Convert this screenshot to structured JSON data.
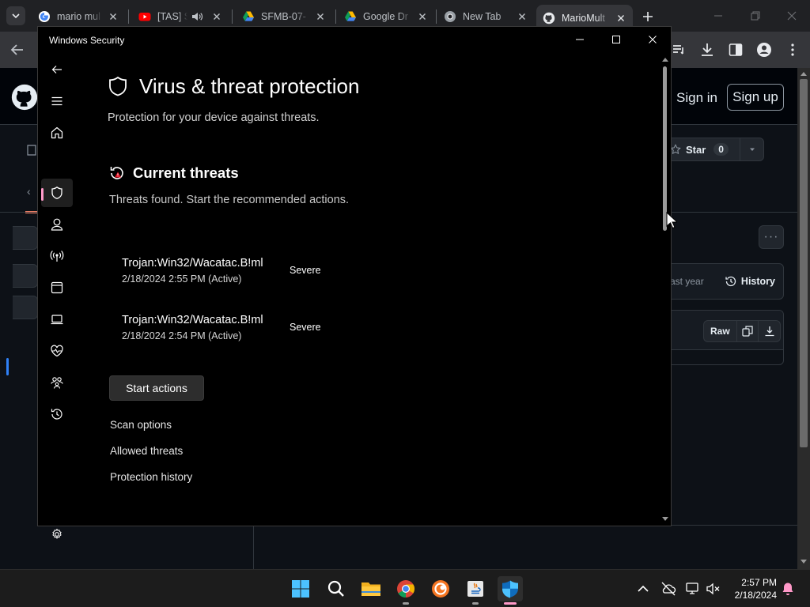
{
  "browser": {
    "tabs": [
      {
        "title": "mario mul",
        "favicon": "google-icon"
      },
      {
        "title": "[TAS] S",
        "favicon": "youtube-icon",
        "audio": true
      },
      {
        "title": "SFMB-07-",
        "favicon": "google-drive-icon"
      },
      {
        "title": "Google Dr",
        "favicon": "google-drive-icon"
      },
      {
        "title": "New Tab",
        "favicon": "chrome-icon"
      },
      {
        "title": "MarioMult",
        "favicon": "github-icon",
        "active": true
      }
    ]
  },
  "github": {
    "sign_in": "Sign in",
    "sign_up": "Sign up",
    "star_label": "Star",
    "star_count": "0",
    "history_prefix": "ast year",
    "history_label": "History",
    "raw_label": "Raw"
  },
  "window": {
    "app_title": "Windows Security",
    "page_title": "Virus & threat protection",
    "page_subtitle": "Protection for your device against threats.",
    "section_title": "Current threats",
    "section_subtitle": "Threats found. Start the recommended actions.",
    "threats": [
      {
        "name": "Trojan:Win32/Wacatac.B!ml",
        "time": "2/18/2024 2:55 PM (Active)",
        "severity": "Severe"
      },
      {
        "name": "Trojan:Win32/Wacatac.B!ml",
        "time": "2/18/2024 2:54 PM (Active)",
        "severity": "Severe"
      }
    ],
    "start_button": "Start actions",
    "links": [
      "Scan options",
      "Allowed threats",
      "Protection history"
    ]
  },
  "taskbar": {
    "time": "2:57 PM",
    "date": "2/18/2024"
  },
  "colors": {
    "accent_pink": "#ff99c8",
    "github_bg": "#0d1117",
    "window_bg": "#000000"
  }
}
